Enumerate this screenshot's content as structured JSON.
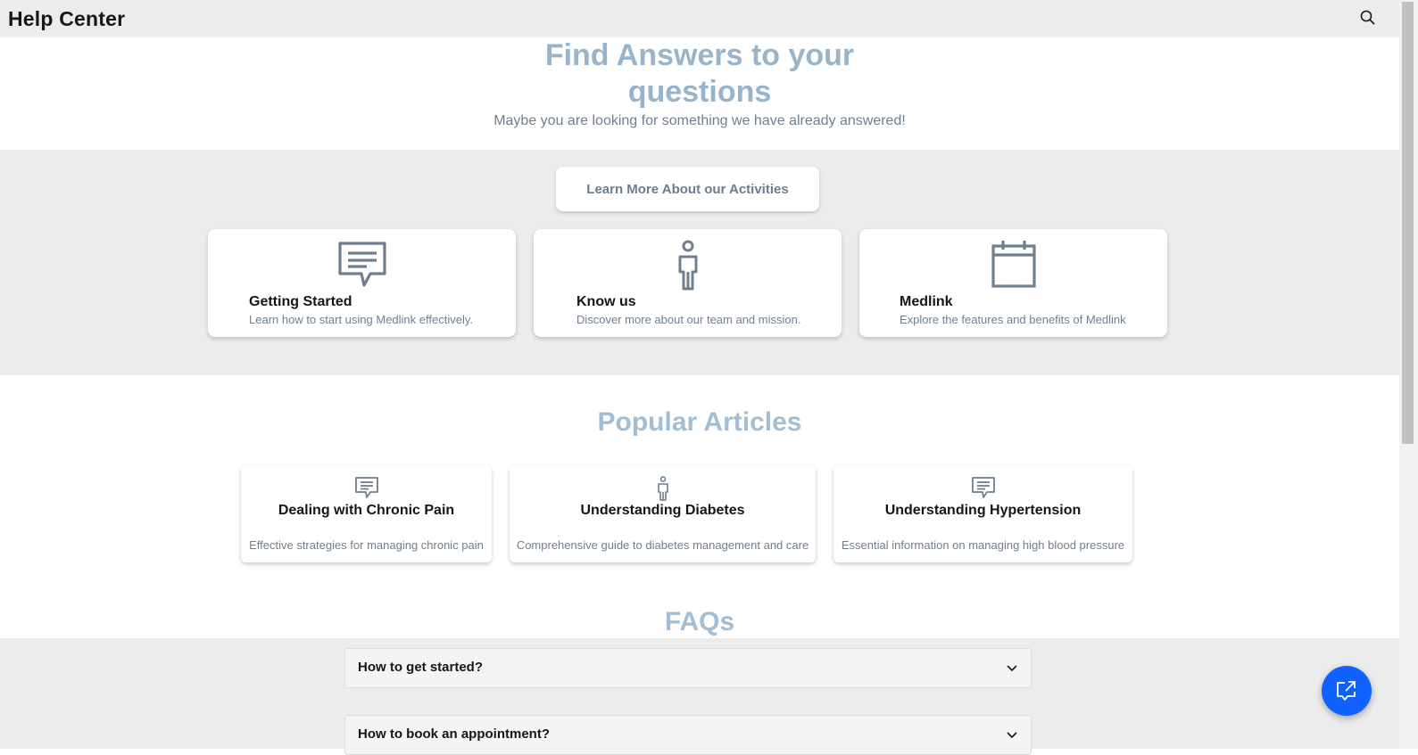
{
  "header": {
    "title": "Help Center",
    "search_icon": "search-icon"
  },
  "hero": {
    "title": "Find Answers to your questions",
    "subtitle": "Maybe you are looking for something we have already answered!"
  },
  "activities": {
    "button_label": "Learn More About our Activities",
    "cards": [
      {
        "icon": "chat-icon",
        "title": "Getting Started",
        "description": "Learn how to start using Medlink effectively."
      },
      {
        "icon": "person-icon",
        "title": "Know us",
        "description": "Discover more about our team and mission."
      },
      {
        "icon": "calendar-icon",
        "title": "Medlink",
        "description": "Explore the features and benefits of Medlink"
      }
    ]
  },
  "popular": {
    "title": "Popular Articles",
    "articles": [
      {
        "icon": "chat-icon",
        "title": "Dealing with Chronic Pain",
        "description": "Effective strategies for managing chronic pain"
      },
      {
        "icon": "person-icon",
        "title": "Understanding Diabetes",
        "description": "Comprehensive guide to diabetes management and care"
      },
      {
        "icon": "chat-icon",
        "title": "Understanding Hypertension",
        "description": "Essential information on managing high blood pressure"
      }
    ]
  },
  "faqs": {
    "title": "FAQs",
    "items": [
      {
        "question": "How to get started?"
      },
      {
        "question": "How to book an appointment?"
      }
    ]
  },
  "colors": {
    "accent": "#0f62fe",
    "heading": "#97b4cc",
    "icon": "#6f7f8f"
  }
}
